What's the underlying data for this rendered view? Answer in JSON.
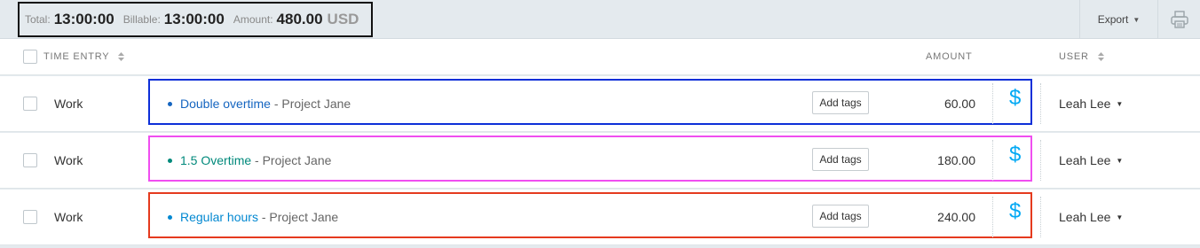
{
  "summary": {
    "total_label": "Total:",
    "total_value": "13:00:00",
    "billable_label": "Billable:",
    "billable_value": "13:00:00",
    "amount_label": "Amount:",
    "amount_value": "480.00",
    "currency": "USD"
  },
  "toolbar": {
    "export_label": "Export",
    "print_icon": "printer-icon"
  },
  "table": {
    "headers": {
      "time_entry": "TIME ENTRY",
      "amount": "AMOUNT",
      "user": "USER"
    },
    "rows": [
      {
        "work": "Work",
        "description": "Double overtime",
        "project_separator": "- Project Jane",
        "tags_label": "Add tags",
        "amount": "60.00",
        "billable_icon": "$",
        "user": "Leah Lee",
        "dot_color": "#1565c0",
        "desc_color": "#1565c0",
        "highlight_color": "#0d2fd8"
      },
      {
        "work": "Work",
        "description": "1.5 Overtime",
        "project_separator": "- Project Jane",
        "tags_label": "Add tags",
        "amount": "180.00",
        "billable_icon": "$",
        "user": "Leah Lee",
        "dot_color": "#00897b",
        "desc_color": "#00897b",
        "highlight_color": "#f04ef0"
      },
      {
        "work": "Work",
        "description": "Regular hours",
        "project_separator": "- Project Jane",
        "tags_label": "Add tags",
        "amount": "240.00",
        "billable_icon": "$",
        "user": "Leah Lee",
        "dot_color": "#0288d1",
        "desc_color": "#0288d1",
        "highlight_color": "#e53a1e"
      }
    ]
  }
}
